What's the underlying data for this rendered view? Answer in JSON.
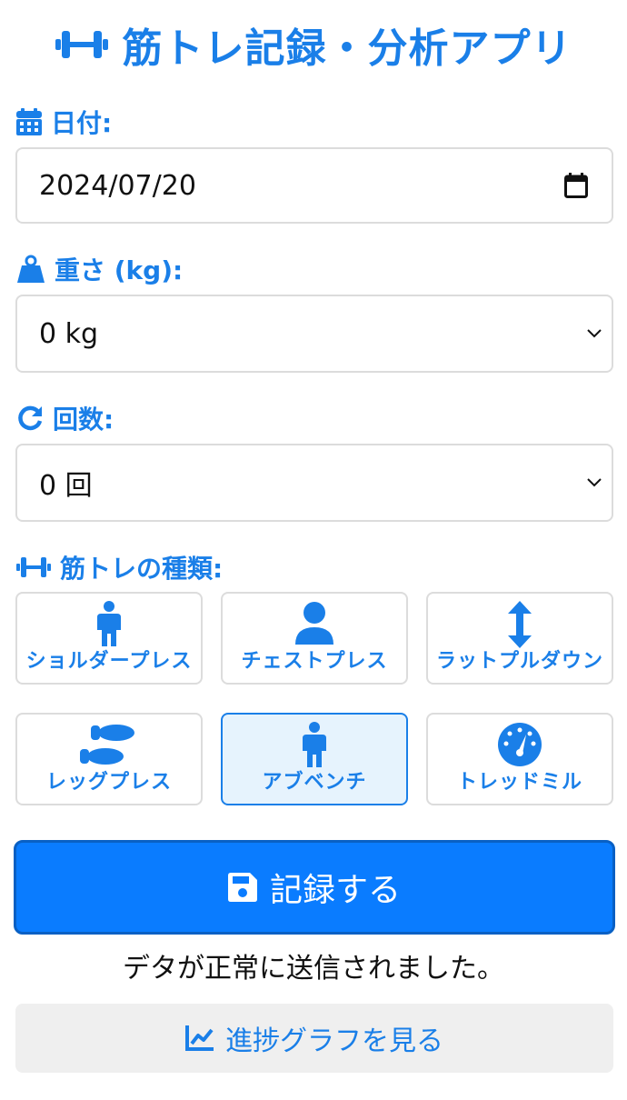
{
  "app": {
    "title": "筋トレ記録・分析アプリ"
  },
  "form": {
    "date_label": "日付:",
    "date_value": "2024/07/20",
    "weight_label": "重さ (kg):",
    "weight_value": "0 kg",
    "reps_label": "回数:",
    "reps_value": "0 回",
    "exercise_label": "筋トレの種類:"
  },
  "exercises": [
    {
      "label": "ショルダープレス",
      "icon": "person-icon",
      "selected": false
    },
    {
      "label": "チェストプレス",
      "icon": "user-icon",
      "selected": false
    },
    {
      "label": "ラットプルダウン",
      "icon": "arrows-vertical-icon",
      "selected": false
    },
    {
      "label": "レッグプレス",
      "icon": "shoe-prints-icon",
      "selected": false
    },
    {
      "label": "アブベンチ",
      "icon": "person-icon",
      "selected": true
    },
    {
      "label": "トレッドミル",
      "icon": "gauge-icon",
      "selected": false
    }
  ],
  "actions": {
    "submit_label": "記録する",
    "status_message": "デタが正常に送信されました。",
    "graph_label": "進捗グラフを見る"
  },
  "colors": {
    "accent": "#1a7fe8",
    "primary_button": "#0a7cff",
    "selected_bg": "#e6f3fd"
  }
}
